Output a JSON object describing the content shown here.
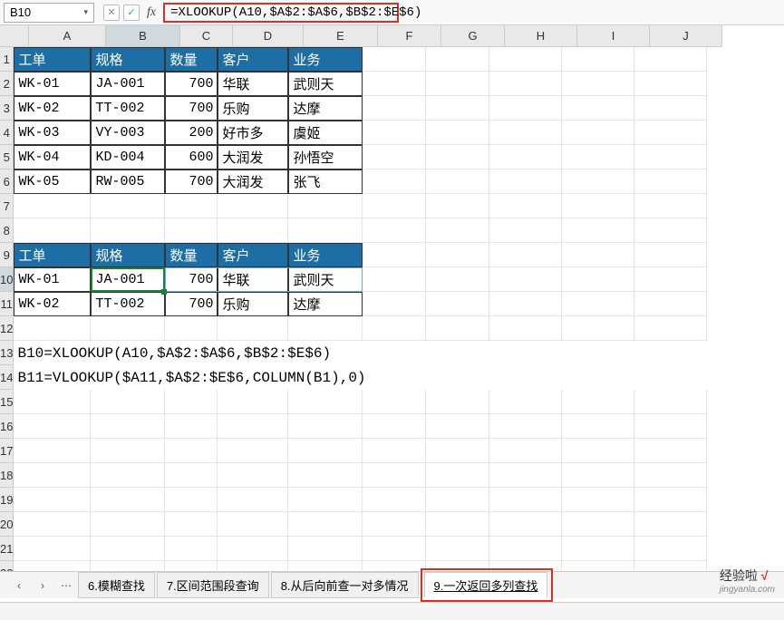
{
  "nameBox": "B10",
  "formula": "=XLOOKUP(A10,$A$2:$A$6,$B$2:$E$6)",
  "columns": [
    "A",
    "B",
    "C",
    "D",
    "E",
    "F",
    "G",
    "H",
    "I",
    "J"
  ],
  "rowCount": 22,
  "headers": {
    "c1": "工单",
    "c2": "规格",
    "c3": "数量",
    "c4": "客户",
    "c5": "业务"
  },
  "table1": [
    {
      "c1": "WK-01",
      "c2": "JA-001",
      "c3": "700",
      "c4": "华联",
      "c5": "武则天"
    },
    {
      "c1": "WK-02",
      "c2": "TT-002",
      "c3": "700",
      "c4": "乐购",
      "c5": "达摩"
    },
    {
      "c1": "WK-03",
      "c2": "VY-003",
      "c3": "200",
      "c4": "好市多",
      "c5": "虞姬"
    },
    {
      "c1": "WK-04",
      "c2": "KD-004",
      "c3": "600",
      "c4": "大润发",
      "c5": "孙悟空"
    },
    {
      "c1": "WK-05",
      "c2": "RW-005",
      "c3": "700",
      "c4": "大润发",
      "c5": "张飞"
    }
  ],
  "headers2": {
    "c1": "工单",
    "c2": "规格",
    "c3": "数量",
    "c4": "客户",
    "c5": "业务"
  },
  "table2": [
    {
      "c1": "WK-01",
      "c2": "JA-001",
      "c3": "700",
      "c4": "华联",
      "c5": "武则天"
    },
    {
      "c1": "WK-02",
      "c2": "TT-002",
      "c3": "700",
      "c4": "乐购",
      "c5": "达摩"
    }
  ],
  "formulas": {
    "r13": "B10=XLOOKUP(A10,$A$2:$A$6,$B$2:$E$6)",
    "r14": "B11=VLOOKUP($A11,$A$2:$E$6,COLUMN(B1),0)"
  },
  "tabs": {
    "t1": "6.模糊查找",
    "t2": "7.区间范围段查询",
    "t3": "8.从后向前查一对多情况",
    "t4": "9.一次返回多列查找"
  },
  "watermark": {
    "text": "经验啦",
    "check": "√",
    "domain": "jingyanla.com"
  },
  "icons": {
    "cancel": "✕",
    "accept": "✓",
    "fx": "fx",
    "dd": "▾",
    "left": "‹",
    "right": "›",
    "more": "⋯"
  }
}
